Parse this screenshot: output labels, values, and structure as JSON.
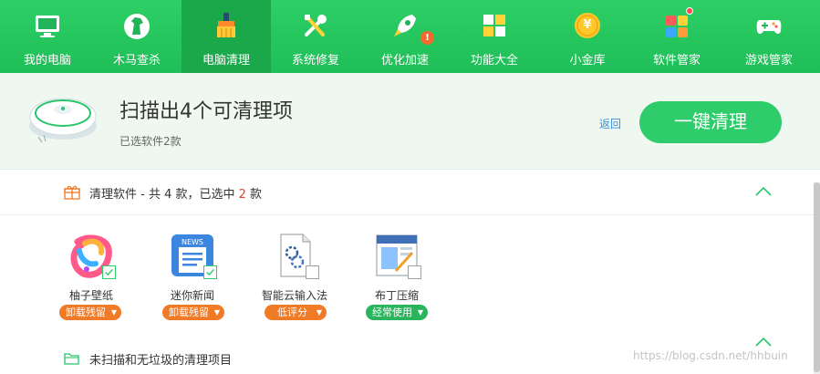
{
  "nav": {
    "items": [
      {
        "label": "我的电脑",
        "icon": "monitor-icon"
      },
      {
        "label": "木马查杀",
        "icon": "horse-icon"
      },
      {
        "label": "电脑清理",
        "icon": "broom-icon",
        "active": true
      },
      {
        "label": "系统修复",
        "icon": "wrench-screwdriver-icon"
      },
      {
        "label": "优化加速",
        "icon": "rocket-icon",
        "alert": "!"
      },
      {
        "label": "功能大全",
        "icon": "grid-icon"
      },
      {
        "label": "小金库",
        "icon": "coin-icon",
        "coin_symbol": "¥"
      },
      {
        "label": "软件管家",
        "icon": "apps-icon"
      },
      {
        "label": "游戏管家",
        "icon": "gamepad-icon"
      }
    ],
    "accent": "#22c55e"
  },
  "summary": {
    "title": "扫描出4个可清理项",
    "subtitle": "已选软件2款",
    "back_label": "返回",
    "clean_label": "一键清理",
    "robot_icon": "robot-vacuum-icon"
  },
  "section1": {
    "title_prefix": "清理软件 - 共 4 款，已选中 ",
    "selected_count": "2",
    "title_suffix": " 款",
    "icon": "gift-icon"
  },
  "apps": [
    {
      "name": "柚子壁纸",
      "action": "卸载残留",
      "badge_color": "orange",
      "checked": true,
      "icon": "youzi-wallpaper-icon"
    },
    {
      "name": "迷你新闻",
      "action": "卸载残留",
      "badge_color": "orange",
      "checked": true,
      "icon": "news-icon",
      "icon_text": "NEWS"
    },
    {
      "name": "智能云输入法",
      "action": "低评分",
      "badge_color": "orange",
      "checked": false,
      "icon": "input-method-icon"
    },
    {
      "name": "布丁压缩",
      "action": "经常使用",
      "badge_color": "green",
      "checked": false,
      "icon": "compress-icon"
    }
  ],
  "section2": {
    "title": "未扫描和无垃圾的清理项目",
    "icon": "folder-icon"
  },
  "watermark": "https://blog.csdn.net/hhbuin"
}
